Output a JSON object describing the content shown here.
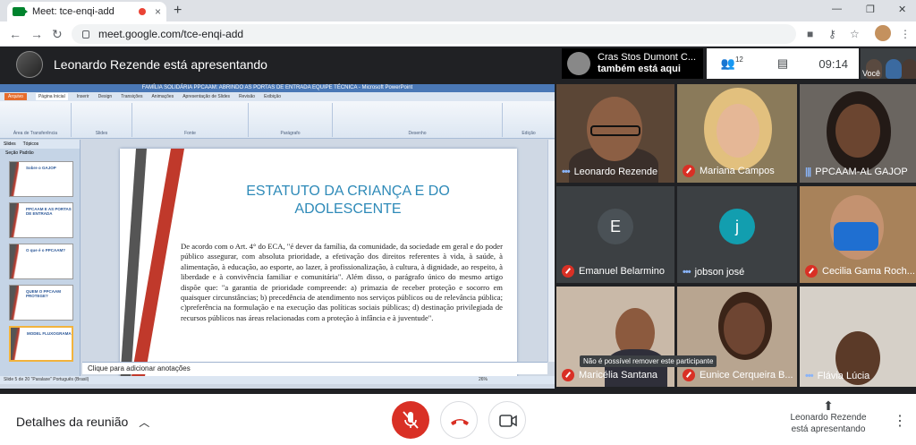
{
  "browser": {
    "tab_title": "Meet: tce-enqi-add",
    "url": "meet.google.com/tce-enqi-add",
    "new_tab": "+",
    "close_tab": "×",
    "win_min": "—",
    "win_max": "❐",
    "win_close": "✕"
  },
  "meet": {
    "presenter_banner": "Leonardo Rezende está apresentando",
    "also_here_name": "Cras Stos Dumont C...",
    "also_here_text": "também está aqui",
    "participants_count": "12",
    "time": "09:14",
    "self_label": "Você",
    "tooltip": "Não é possível remover este participante",
    "details_label": "Detalhes da reunião",
    "presenting_name": "Leonardo Rezende",
    "presenting_text": "está apresentando",
    "participants": [
      {
        "name": "Leonardo Rezende",
        "status": "speaking"
      },
      {
        "name": "Mariana Campos",
        "status": "muted"
      },
      {
        "name": "PPCAAM-AL GAJOP",
        "status": "speaking"
      },
      {
        "name": "Emanuel Belarmino",
        "status": "muted",
        "initial": "E",
        "color": "#4a5156"
      },
      {
        "name": "jobson josé",
        "status": "speaking",
        "initial": "j",
        "color": "#129eaf"
      },
      {
        "name": "Cecilia Gama Roch...",
        "status": "muted"
      },
      {
        "name": "Maricélia Santana",
        "status": "muted"
      },
      {
        "name": "Eunice Cerqueira B...",
        "status": "muted"
      },
      {
        "name": "Flávia Lúcia",
        "status": "speaking"
      }
    ]
  },
  "ppt": {
    "window_title": "FAMÍLIA SOLIDÁRIA PPCAAM: ABRINDO AS PORTAS DE ENTRADA EQUIPE TÉCNICA - Microsoft PowerPoint",
    "tabs": [
      "Arquivo",
      "Página Inicial",
      "Inserir",
      "Design",
      "Transições",
      "Animações",
      "Apresentação de Slides",
      "Revisão",
      "Exibição"
    ],
    "groups": [
      "Área de Transferência",
      "Slides",
      "Fonte",
      "Parágrafo",
      "Desenho",
      "Edição"
    ],
    "pane_tabs": [
      "Slides",
      "Tópicos"
    ],
    "section": "Seção Padrão",
    "thumbs": [
      {
        "n": "1",
        "t": "Sobre o GAJOP"
      },
      {
        "n": "2",
        "t": "PPCAAM E AS PORTAS DE ENTRADA"
      },
      {
        "n": "3",
        "t": "O que é o PPCAAM?"
      },
      {
        "n": "4",
        "t": "QUEM O PPCAAM PROTEGE?"
      },
      {
        "n": "5",
        "t": "MODEL FLUXOGRAMA"
      }
    ],
    "slide_title": "ESTATUTO DA CRIANÇA E DO ADOLESCENTE",
    "slide_body": "De acordo com o Art. 4° do ECA, \"é dever da família, da comunidade, da sociedade em geral e do poder público assegurar, com absoluta prioridade, a efetivação dos direitos referentes à vida, à saúde, à alimentação, à educação, ao esporte, ao lazer, à profissionalização, à cultura, à dignidade, ao respeito, à liberdade e à convivência familiar e comunitária\". Além disso, o parágrafo único do mesmo artigo dispõe que: \"a garantia de prioridade compreende: a) primazia de receber proteção e socorro em quaisquer circunstâncias; b) precedência de atendimento nos serviços públicos ou de relevância pública; c)preferência na formulação e na execução das políticas sociais públicas; d) destinação privilegiada de recursos públicos nas áreas relacionadas com a proteção à infância e à juventude\".",
    "notes": "Clique para adicionar anotações",
    "status": "Slide 5 de 20    \"Paralaxe\"    Português (Brasil)",
    "zoom": "26%"
  }
}
